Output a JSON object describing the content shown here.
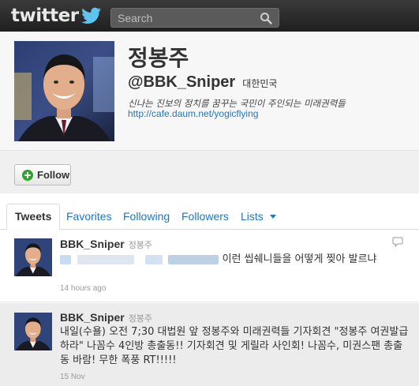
{
  "topbar": {
    "logo_text": "twitter",
    "search": {
      "placeholder": "Search",
      "value": ""
    }
  },
  "profile": {
    "name": "정봉주",
    "handle": "@BBK_Sniper",
    "location": "대한민국",
    "bio": "신나는 진보의 정치를 꿈꾸는 국민이 주인되는 미래권력들",
    "url": "http://cafe.daum.net/yogicflying"
  },
  "actions": {
    "follow_label": "Follow"
  },
  "tabs": [
    {
      "label": "Tweets",
      "active": true
    },
    {
      "label": "Favorites"
    },
    {
      "label": "Following"
    },
    {
      "label": "Followers"
    },
    {
      "label": "Lists"
    }
  ],
  "tweets": [
    {
      "username": "BBK_Sniper",
      "realname": "정봉주",
      "text": "이런 씹쉐니들을 어떻게 찢아 발르냐",
      "time": "14 hours ago"
    },
    {
      "username": "BBK_Sniper",
      "realname": "정봉주",
      "text": "내일(수욜) 오전 7;30 대법원 앞 정봉주와 미래권력들 기자회견 \"정봉주 여권발급하라\" 나꼼수 4인방 총출동!! 기자회견 및 게릴라 사인회! 나꼼수, 미권스팬 총출동 바람! 무한 폭풍 RT!!!!!",
      "time": "15 Nov"
    }
  ],
  "colors": {
    "topbar": "#2b2b2b",
    "link": "#2276bb",
    "follow_icon": "#2ea32e",
    "bird": "#5ec3ee"
  },
  "icons": [
    "twitter-bird-icon",
    "search-icon",
    "follow-plus-icon",
    "chevron-down-icon",
    "reply-icon"
  ]
}
